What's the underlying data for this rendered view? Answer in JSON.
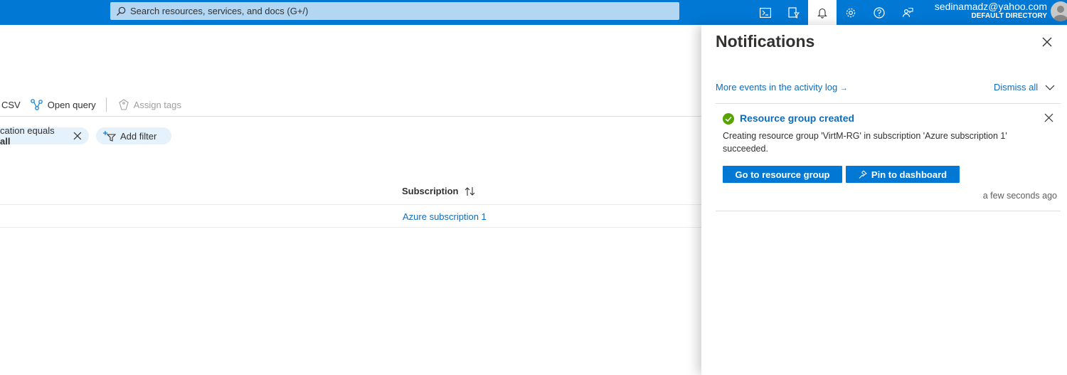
{
  "topbar": {
    "search_placeholder": "Search resources, services, and docs (G+/)",
    "icons": [
      "cloud-shell-icon",
      "directory-filter-icon",
      "bell-icon",
      "gear-icon",
      "help-icon",
      "feedback-icon"
    ],
    "account_name": "sedinamadz@yahoo.com",
    "account_directory": "DEFAULT DIRECTORY"
  },
  "toolbar": {
    "csv_label": "CSV",
    "open_query_label": "Open query",
    "assign_tags_label": "Assign tags"
  },
  "filters": {
    "location_prefix": "cation equals ",
    "location_value": "all",
    "add_filter_label": "Add filter"
  },
  "table": {
    "subscription_header": "Subscription",
    "rows": [
      {
        "subscription": "Azure subscription 1"
      }
    ]
  },
  "notifications": {
    "title": "Notifications",
    "more_events_label": "More events in the activity log",
    "more_events_arrow": "→",
    "dismiss_all_label": "Dismiss all",
    "items": [
      {
        "title": "Resource group created",
        "body": "Creating resource group 'VirtM-RG' in subscription 'Azure subscription 1' succeeded.",
        "primary_button": "Go to resource group",
        "secondary_button": "Pin to dashboard",
        "time": "a few seconds ago",
        "status": "success"
      }
    ]
  },
  "colors": {
    "brand": "#0078d4",
    "link": "#0f6cbd",
    "success": "#57a300"
  }
}
